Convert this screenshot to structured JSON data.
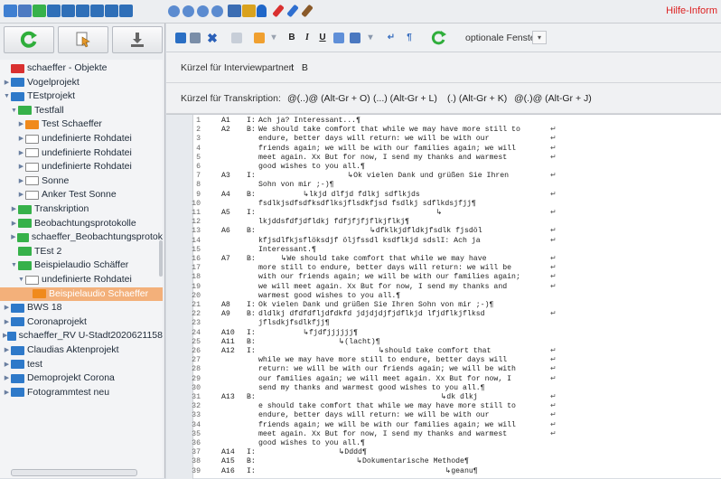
{
  "app": {
    "help_label": "Hilfe-Inform",
    "accent": "#d22222"
  },
  "top_icons": [
    {
      "name": "home-icon",
      "color": "#3f7fd1"
    },
    {
      "name": "grid-icon",
      "color": "#4d7ac2"
    },
    {
      "name": "green-book-icon",
      "color": "#36b14a"
    },
    {
      "name": "bar-icon-1",
      "color": "#2f6fb8"
    },
    {
      "name": "bar-icon-2",
      "color": "#2f6fb8"
    },
    {
      "name": "bar-icon-3",
      "color": "#2f6fb8"
    },
    {
      "name": "bar-icon-4",
      "color": "#2f6fb8"
    },
    {
      "name": "bar-icon-5",
      "color": "#2f6fb8"
    },
    {
      "name": "bar-icon-6",
      "color": "#2f6fb8"
    },
    {
      "name": "play-icon-1",
      "color": "#5b8bd0"
    },
    {
      "name": "play-icon-2",
      "color": "#5b8bd0"
    },
    {
      "name": "play-icon-3",
      "color": "#5b8bd0"
    },
    {
      "name": "play-icon-4",
      "color": "#5b8bd0"
    },
    {
      "name": "cube-icon",
      "color": "#3b6db3"
    },
    {
      "name": "gear-icon",
      "color": "#d9a21e"
    },
    {
      "name": "person-icon",
      "color": "#1f66c8"
    },
    {
      "name": "paperclip-red-icon",
      "color": "#d93030"
    },
    {
      "name": "paperclip-blue-icon",
      "color": "#2f6fd0"
    },
    {
      "name": "pen-icon",
      "color": "#8a5a2a"
    }
  ],
  "toolbar": {
    "bold": "B",
    "italic": "I",
    "underline": "U",
    "return_symbol": "↵",
    "pilcrow": "¶",
    "optional_windows": "optionale Fenster",
    "dropdown_arrow": "▾"
  },
  "info": {
    "interviewer_label": "Kürzel für Interviewpartner:",
    "interviewer_value": "I   B",
    "transcription_label": "Kürzel für Transkription:",
    "transcription_values": [
      "@(..)@ (Alt-Gr + O)",
      "(...) (Alt-Gr + L)",
      "(.) (Alt-Gr + K)",
      "@(.)@ (Alt-Gr + J)"
    ]
  },
  "tree": [
    {
      "label": "schaeffer - Objekte",
      "indent": 0,
      "arrow": "",
      "icon": "red",
      "selected": false
    },
    {
      "label": "Vogelprojekt",
      "indent": 0,
      "arrow": "▶",
      "icon": "blue",
      "selected": false
    },
    {
      "label": "TEstprojekt",
      "indent": 0,
      "arrow": "▼",
      "icon": "blue",
      "selected": false
    },
    {
      "label": "Testfall",
      "indent": 1,
      "arrow": "▼",
      "icon": "green",
      "selected": false
    },
    {
      "label": "Test Schaeffer",
      "indent": 2,
      "arrow": "▶",
      "icon": "orange",
      "selected": false
    },
    {
      "label": "undefinierte Rohdatei",
      "indent": 2,
      "arrow": "▶",
      "icon": "grey",
      "selected": false
    },
    {
      "label": "undefinierte Rohdatei",
      "indent": 2,
      "arrow": "▶",
      "icon": "grey",
      "selected": false
    },
    {
      "label": "undefinierte Rohdatei",
      "indent": 2,
      "arrow": "▶",
      "icon": "grey",
      "selected": false
    },
    {
      "label": "Sonne",
      "indent": 2,
      "arrow": "▶",
      "icon": "grey",
      "selected": false
    },
    {
      "label": "Anker Test Sonne",
      "indent": 2,
      "arrow": "▶",
      "icon": "grey",
      "selected": false
    },
    {
      "label": "Transkription",
      "indent": 1,
      "arrow": "▶",
      "icon": "green",
      "selected": false
    },
    {
      "label": "Beobachtungsprotokolle",
      "indent": 1,
      "arrow": "▶",
      "icon": "green",
      "selected": false
    },
    {
      "label": "schaeffer_Beobachtungsprotok",
      "indent": 1,
      "arrow": "▶",
      "icon": "green",
      "selected": false
    },
    {
      "label": "TEst 2",
      "indent": 1,
      "arrow": "",
      "icon": "green",
      "selected": false
    },
    {
      "label": "Beispielaudio Schäffer",
      "indent": 1,
      "arrow": "▼",
      "icon": "green",
      "selected": false
    },
    {
      "label": "undefinierte Rohdatei",
      "indent": 2,
      "arrow": "▼",
      "icon": "grey",
      "selected": false
    },
    {
      "label": "Beispielaudio Schaeffer",
      "indent": 3,
      "arrow": "",
      "icon": "orange",
      "selected": true
    },
    {
      "label": "BWS 18",
      "indent": 0,
      "arrow": "▶",
      "icon": "blue",
      "selected": false
    },
    {
      "label": "Coronaprojekt",
      "indent": 0,
      "arrow": "▶",
      "icon": "blue",
      "selected": false
    },
    {
      "label": "schaeffer_RV U-Stadt2020621158",
      "indent": 0,
      "arrow": "▶",
      "icon": "blue",
      "selected": false
    },
    {
      "label": "Claudias Aktenprojekt",
      "indent": 0,
      "arrow": "▶",
      "icon": "blue",
      "selected": false
    },
    {
      "label": "test",
      "indent": 0,
      "arrow": "▶",
      "icon": "blue",
      "selected": false
    },
    {
      "label": "Demoprojekt Corona",
      "indent": 0,
      "arrow": "▶",
      "icon": "blue",
      "selected": false
    },
    {
      "label": "Fotogrammtest neu",
      "indent": 0,
      "arrow": "▶",
      "icon": "blue",
      "selected": false
    }
  ],
  "transcript": [
    {
      "n": "1",
      "spk": "A1",
      "role": "I:",
      "text": "Ach ja? Interessant...¶",
      "ret": ""
    },
    {
      "n": "2",
      "spk": "A2",
      "role": "B:",
      "text": "We should take comfort that while we may have more still to",
      "ret": "↵"
    },
    {
      "n": "3",
      "spk": "",
      "role": "",
      "text": "endure, better days will return: we will be with our",
      "ret": "↵"
    },
    {
      "n": "4",
      "spk": "",
      "role": "",
      "text": "friends again; we will be with our families again; we will",
      "ret": "↵"
    },
    {
      "n": "5",
      "spk": "",
      "role": "",
      "text": "meet again. Xx But for now, I send my thanks and warmest",
      "ret": "↵"
    },
    {
      "n": "6",
      "spk": "",
      "role": "",
      "text": "good wishes to you all.¶",
      "ret": ""
    },
    {
      "n": "7",
      "spk": "A3",
      "role": "I:",
      "text": "                    ↳Ok vielen Dank und grüßen Sie Ihren",
      "ret": "↵"
    },
    {
      "n": "8",
      "spk": "",
      "role": "",
      "text": "Sohn von mir ;-)¶",
      "ret": ""
    },
    {
      "n": "9",
      "spk": "A4",
      "role": "B:",
      "text": "          ↳lkjd dlfjd fdlkj sdflkjds",
      "ret": "↵"
    },
    {
      "n": "10",
      "spk": "",
      "role": "",
      "text": "fsdlkjsdfsdfksdflksjflsdkfjsd fsdlkj sdflkdsjfjj¶",
      "ret": ""
    },
    {
      "n": "11",
      "spk": "A5",
      "role": "I:",
      "text": "                                        ↳",
      "ret": "↵"
    },
    {
      "n": "12",
      "spk": "",
      "role": "",
      "text": "lkjddsfdfjdfldkj fdfjfjfjflkjflkj¶",
      "ret": ""
    },
    {
      "n": "13",
      "spk": "A6",
      "role": "B:",
      "text": "                         ↳dfklkjdfldkjfsdlk fjsdöl",
      "ret": "↵"
    },
    {
      "n": "14",
      "spk": "",
      "role": "",
      "text": "kfjsdlfkjsflöksdjf öljfssdl ksdflkjd sdslI: Ach ja",
      "ret": "↵"
    },
    {
      "n": "15",
      "spk": "",
      "role": "",
      "text": "Interessant.¶",
      "ret": ""
    },
    {
      "n": "16",
      "spk": "A7",
      "role": "B:",
      "text": "     ↳We should take comfort that while we may have",
      "ret": "↵"
    },
    {
      "n": "17",
      "spk": "",
      "role": "",
      "text": "more still to endure, better days will return: we will be",
      "ret": "↵"
    },
    {
      "n": "18",
      "spk": "",
      "role": "",
      "text": "with our friends again; we will be with our families again;",
      "ret": "↵"
    },
    {
      "n": "19",
      "spk": "",
      "role": "",
      "text": "we will meet again. Xx But for now, I send my thanks and",
      "ret": "↵"
    },
    {
      "n": "20",
      "spk": "",
      "role": "",
      "text": "warmest good wishes to you all.¶",
      "ret": ""
    },
    {
      "n": "21",
      "spk": "A8",
      "role": "I:",
      "text": "Ok vielen Dank und grüßen Sie Ihren Sohn von mir ;-)¶",
      "ret": ""
    },
    {
      "n": "22",
      "spk": "A9",
      "role": "B:",
      "text": "dldlkj dfdfdfljdfdkfd jdjdjdjfjdflkjd lfjdflkjflksd",
      "ret": "↵"
    },
    {
      "n": "23",
      "spk": "",
      "role": "",
      "text": "jflsdkjfsdlkfjj¶",
      "ret": ""
    },
    {
      "n": "24",
      "spk": "A10",
      "role": "I:",
      "text": "          ↳fjdfjjjjjj¶",
      "ret": ""
    },
    {
      "n": "25",
      "spk": "A11",
      "role": "B:",
      "text": "                  ↳(lacht)¶",
      "ret": ""
    },
    {
      "n": "26",
      "spk": "A12",
      "role": "I:",
      "text": "                           ↳should take comfort that",
      "ret": "↵"
    },
    {
      "n": "27",
      "spk": "",
      "role": "",
      "text": "while we may have more still to endure, better days will",
      "ret": "↵"
    },
    {
      "n": "28",
      "spk": "",
      "role": "",
      "text": "return: we will be with our friends again; we will be with",
      "ret": "↵"
    },
    {
      "n": "29",
      "spk": "",
      "role": "",
      "text": "our families again; we will meet again. Xx But for now, I",
      "ret": "↵"
    },
    {
      "n": "30",
      "spk": "",
      "role": "",
      "text": "send my thanks and warmest good wishes to you all.¶",
      "ret": ""
    },
    {
      "n": "31",
      "spk": "A13",
      "role": "B:",
      "text": "                                         ↳dk dlkj",
      "ret": "↵"
    },
    {
      "n": "32",
      "spk": "",
      "role": "",
      "text": "e should take comfort that while we may have more still to",
      "ret": "↵"
    },
    {
      "n": "33",
      "spk": "",
      "role": "",
      "text": "endure, better days will return: we will be with our",
      "ret": "↵"
    },
    {
      "n": "34",
      "spk": "",
      "role": "",
      "text": "friends again; we will be with our families again; we will",
      "ret": "↵"
    },
    {
      "n": "35",
      "spk": "",
      "role": "",
      "text": "meet again. Xx But for now, I send my thanks and warmest",
      "ret": "↵"
    },
    {
      "n": "36",
      "spk": "",
      "role": "",
      "text": "good wishes to you all.¶",
      "ret": ""
    },
    {
      "n": "37",
      "spk": "A14",
      "role": "I:",
      "text": "                  ↳Dddd¶",
      "ret": ""
    },
    {
      "n": "38",
      "spk": "A15",
      "role": "B:",
      "text": "                      ↳Dokumentarische Methode¶",
      "ret": ""
    },
    {
      "n": "39",
      "spk": "A16",
      "role": "I:",
      "text": "                                          ↳geanu¶",
      "ret": ""
    }
  ]
}
